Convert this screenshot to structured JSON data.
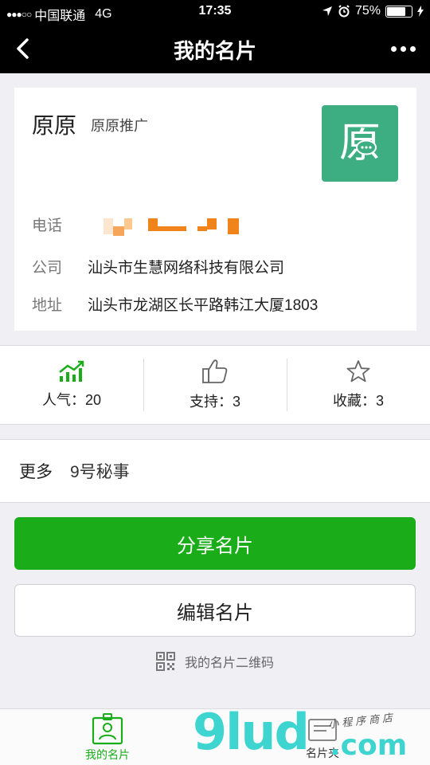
{
  "status_bar": {
    "signal": "●●●○○",
    "carrier": "中国联通",
    "network": "4G",
    "time": "17:35",
    "battery_percent": "75%",
    "battery_level": 0.75
  },
  "nav": {
    "title": "我的名片"
  },
  "card": {
    "name": "原原",
    "tag": "原原推广",
    "logo_char": "原",
    "logo_color": "#3cae82",
    "phone_label": "电话",
    "company_label": "公司",
    "company_value": "汕头市生慧网络科技有限公司",
    "address_label": "地址",
    "address_value": "汕头市龙湖区长平路韩江大厦1803"
  },
  "stats": {
    "popularity": "人气：20",
    "support": "支持：3",
    "favorites": "收藏：3"
  },
  "more": {
    "label": "更多",
    "value": "9号秘事"
  },
  "buttons": {
    "share": "分享名片",
    "edit": "编辑名片",
    "qr": "我的名片二维码"
  },
  "tab_bar": {
    "mine": "我的名片",
    "folder": "名片夹"
  },
  "watermark": {
    "main": "9lud",
    "com": ".com",
    "sub": "小程序商店"
  },
  "colors": {
    "accent": "#1aad19",
    "watermark": "#3ed4d0",
    "phone_blur": "#f0831a"
  }
}
